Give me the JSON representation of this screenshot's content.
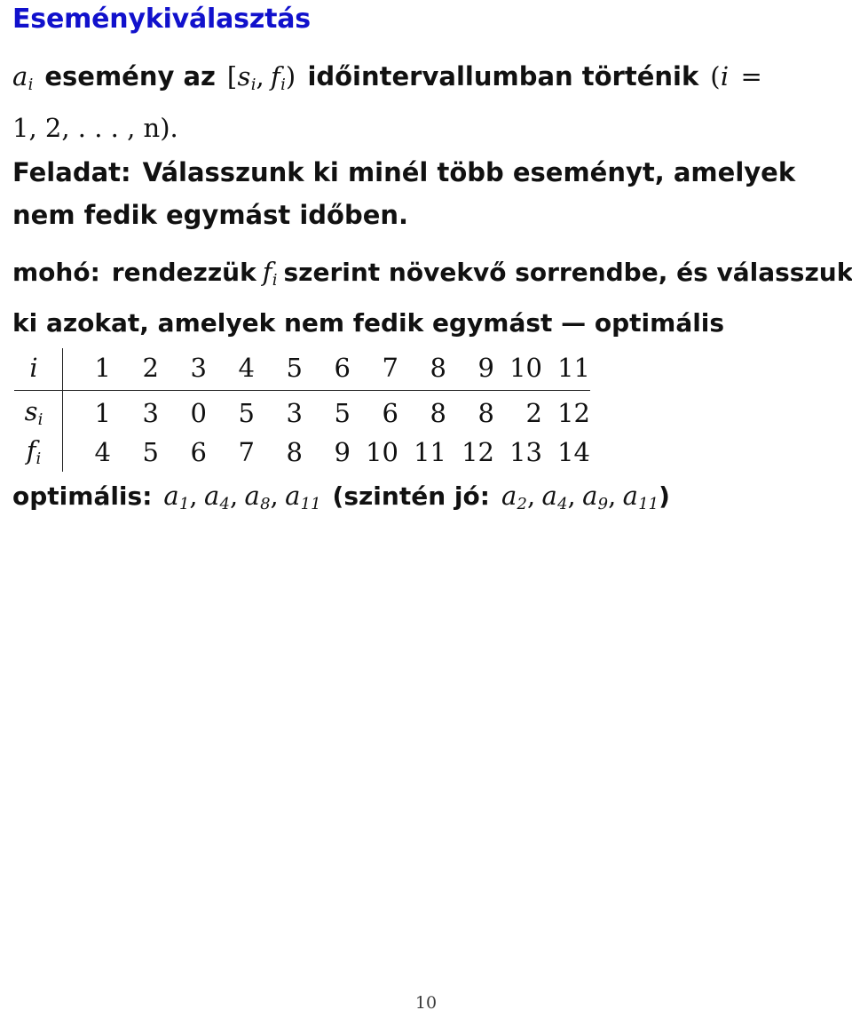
{
  "slide": {
    "title": "Eseménykiválasztás",
    "page_number": "10",
    "title_color": "#1111cc",
    "accent_color": "#1111cc",
    "text_color": "#111111",
    "background_color": "#ffffff"
  },
  "intro": {
    "line1_part1": "esemény az",
    "line1_math_a": "a",
    "line1_math_a_sub": "i",
    "line1_interval_open": "[",
    "line1_interval_s": "s",
    "line1_interval_s_sub": "i",
    "line1_interval_comma": ",",
    "line1_interval_f": "f",
    "line1_interval_f_sub": "i",
    "line1_interval_close": ")",
    "line1_part2": "időintervallumban történik",
    "line1_paren_open": "(",
    "line1_index_var": "i",
    "line1_equals": "=",
    "line2": "1, 2, . . . , n)."
  },
  "task": {
    "label": "Feladat:",
    "line1": "Válasszunk ki minél több eseményt, amelyek",
    "line2": "nem fedik egymást időben."
  },
  "greedy": {
    "label": "mohó:",
    "line1_part1": "rendezzük",
    "line1_math_f": "f",
    "line1_math_f_sub": "i",
    "line1_part2": "szerint növekvő sorrendbe, és válasszuk",
    "line2": "ki azokat, amelyek nem fedik egymást — optimális"
  },
  "table": {
    "row_labels": [
      "i",
      "s",
      "f"
    ],
    "row_label_subs": [
      "",
      "i",
      "i"
    ],
    "header": [
      "1",
      "2",
      "3",
      "4",
      "5",
      "6",
      "7",
      "8",
      "9",
      "10",
      "11"
    ],
    "rows": [
      {
        "label": "s",
        "sub": "i",
        "values": [
          "1",
          "3",
          "0",
          "5",
          "3",
          "5",
          "6",
          "8",
          "8",
          "2",
          "12"
        ]
      },
      {
        "label": "f",
        "sub": "i",
        "values": [
          "4",
          "5",
          "6",
          "7",
          "8",
          "9",
          "10",
          "11",
          "12",
          "13",
          "14"
        ]
      }
    ]
  },
  "result": {
    "label": "optimális:",
    "solution": [
      "a1",
      "a4",
      "a8",
      "a11"
    ],
    "solution_base": [
      "a",
      "a",
      "a",
      "a"
    ],
    "solution_subs": [
      "1",
      "4",
      "8",
      "11"
    ],
    "alt_label": "(szintén jó:",
    "alt_solution_base": [
      "a",
      "a",
      "a",
      "a"
    ],
    "alt_solution_subs": [
      "2",
      "4",
      "9",
      "11"
    ],
    "close_paren": ")"
  }
}
